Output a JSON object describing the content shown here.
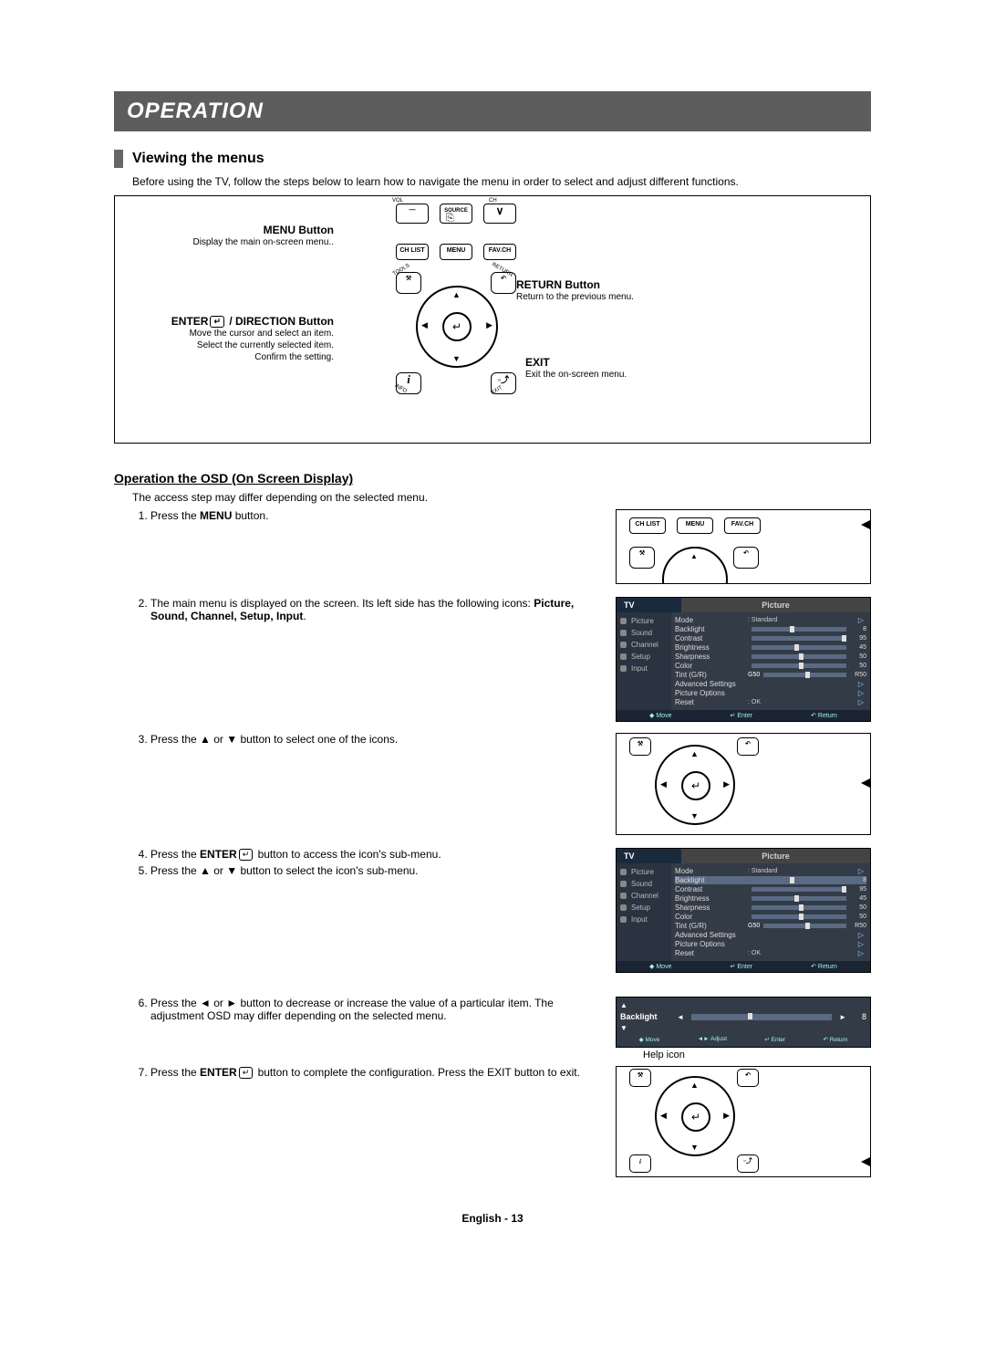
{
  "header": "OPERATION",
  "section_title": "Viewing the menus",
  "intro": "Before using the TV, follow the steps below to learn how to navigate the menu in order to select and adjust different functions.",
  "callouts": {
    "menu": {
      "title": "MENU Button",
      "desc": "Display the main on-screen menu.."
    },
    "enter": {
      "title_prefix": "ENTER",
      "title_suffix": " / DIRECTION Button",
      "desc1": "Move the cursor and select an item.",
      "desc2": "Select the currently selected item.",
      "desc3": "Confirm the setting."
    },
    "return": {
      "title": "RETURN Button",
      "desc": "Return to the previous menu."
    },
    "exit": {
      "title": "EXIT",
      "desc": "Exit the on-screen menu."
    }
  },
  "remote_labels": {
    "vol": "VOL",
    "ch": "CH",
    "source": "SOURCE",
    "chlist": "CH LIST",
    "menu": "MENU",
    "favch": "FAV.CH",
    "tools": "TOOLS",
    "return": "RETURN",
    "info": "INFO",
    "exit": "EXIT"
  },
  "subheading": "Operation the OSD (On Screen Display)",
  "access_note": "The access step may differ depending on the selected menu.",
  "steps": {
    "s1_a": "Press the ",
    "s1_b": "MENU",
    "s1_c": " button.",
    "s2_a": "The main menu is displayed on the screen. Its left side has the following icons: ",
    "s2_b": "Picture, Sound, Channel, Setup, Input",
    "s2_c": ".",
    "s3": "Press the ▲ or ▼ button to select one of the icons.",
    "s4_a": "Press the ",
    "s4_b": "ENTER",
    "s4_c": " button to access the icon's sub-menu.",
    "s5": "Press the ▲ or ▼ button to select the icon's sub-menu.",
    "s6": "Press the ◄ or ► button to decrease or increase the value of a particular item. The adjustment OSD may differ depending on the selected menu.",
    "s7_a": "Press the ",
    "s7_b": "ENTER",
    "s7_c": " button to complete the configuration. Press the EXIT button to exit."
  },
  "osd": {
    "tv": "TV",
    "category": "Picture",
    "side": [
      "Picture",
      "Sound",
      "Channel",
      "Setup",
      "Input"
    ],
    "rows": [
      {
        "label": "Mode",
        "type": "text",
        "value": ": Standard"
      },
      {
        "label": "Backlight",
        "type": "slider",
        "value": "8",
        "pct": 40
      },
      {
        "label": "Contrast",
        "type": "slider",
        "value": "95",
        "pct": 95
      },
      {
        "label": "Brightness",
        "type": "slider",
        "value": "45",
        "pct": 45
      },
      {
        "label": "Sharpness",
        "type": "slider",
        "value": "50",
        "pct": 50
      },
      {
        "label": "Color",
        "type": "slider",
        "value": "50",
        "pct": 50
      },
      {
        "label": "Tint (G/R)",
        "type": "slider",
        "prefix": "G50",
        "value": "R50",
        "pct": 50
      },
      {
        "label": "Advanced Settings",
        "type": "arrow"
      },
      {
        "label": "Picture Options",
        "type": "arrow"
      },
      {
        "label": "Reset",
        "type": "text",
        "value": ": OK"
      }
    ],
    "foot": {
      "move": "Move",
      "enter": "Enter",
      "return": "Return"
    }
  },
  "backlight": {
    "label": "Backlight",
    "value": "8",
    "foot": {
      "move": "Move",
      "adjust": "Adjust",
      "enter": "Enter",
      "return": "Return"
    }
  },
  "help_icon": "Help icon",
  "footer": "English - 13",
  "glyphs": {
    "enter": "↵",
    "updown": "◆",
    "leftright": "◄►",
    "ret": "↶",
    "tri_r": "▷"
  }
}
